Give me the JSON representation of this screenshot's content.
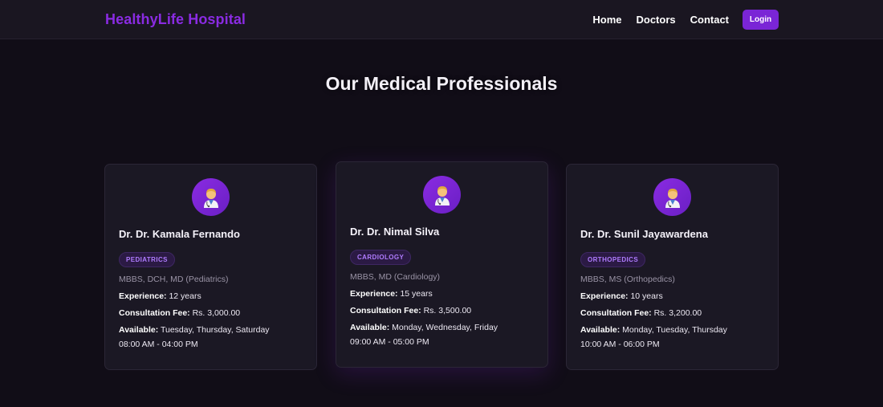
{
  "navbar": {
    "brand": "HealthyLife Hospital",
    "links": [
      "Home",
      "Doctors",
      "Contact"
    ],
    "login_label": "Login"
  },
  "page": {
    "title": "Our Medical Professionals"
  },
  "labels": {
    "experience": "Experience:",
    "fee": "Consultation Fee:",
    "available": "Available:"
  },
  "doctors": [
    {
      "name": "Dr. Dr. Kamala Fernando",
      "specialty": "PEDIATRICS",
      "qualifications": "MBBS, DCH, MD (Pediatrics)",
      "experience": "12 years",
      "fee": "Rs. 3,000.00",
      "days": "Tuesday, Thursday, Saturday",
      "hours": "08:00 AM - 04:00 PM"
    },
    {
      "name": "Dr. Dr. Nimal Silva",
      "specialty": "CARDIOLOGY",
      "qualifications": "MBBS, MD (Cardiology)",
      "experience": "15 years",
      "fee": "Rs. 3,500.00",
      "days": "Monday, Wednesday, Friday",
      "hours": "09:00 AM - 05:00 PM"
    },
    {
      "name": "Dr. Dr. Sunil Jayawardena",
      "specialty": "ORTHOPEDICS",
      "qualifications": "MBBS, MS (Orthopedics)",
      "experience": "10 years",
      "fee": "Rs. 3,200.00",
      "days": "Monday, Tuesday, Thursday",
      "hours": "10:00 AM - 06:00 PM"
    }
  ],
  "icons": {
    "avatar": "doctor-icon"
  },
  "colors": {
    "accent": "#8a2be2",
    "background": "#110d17",
    "card": "#1b1824"
  }
}
